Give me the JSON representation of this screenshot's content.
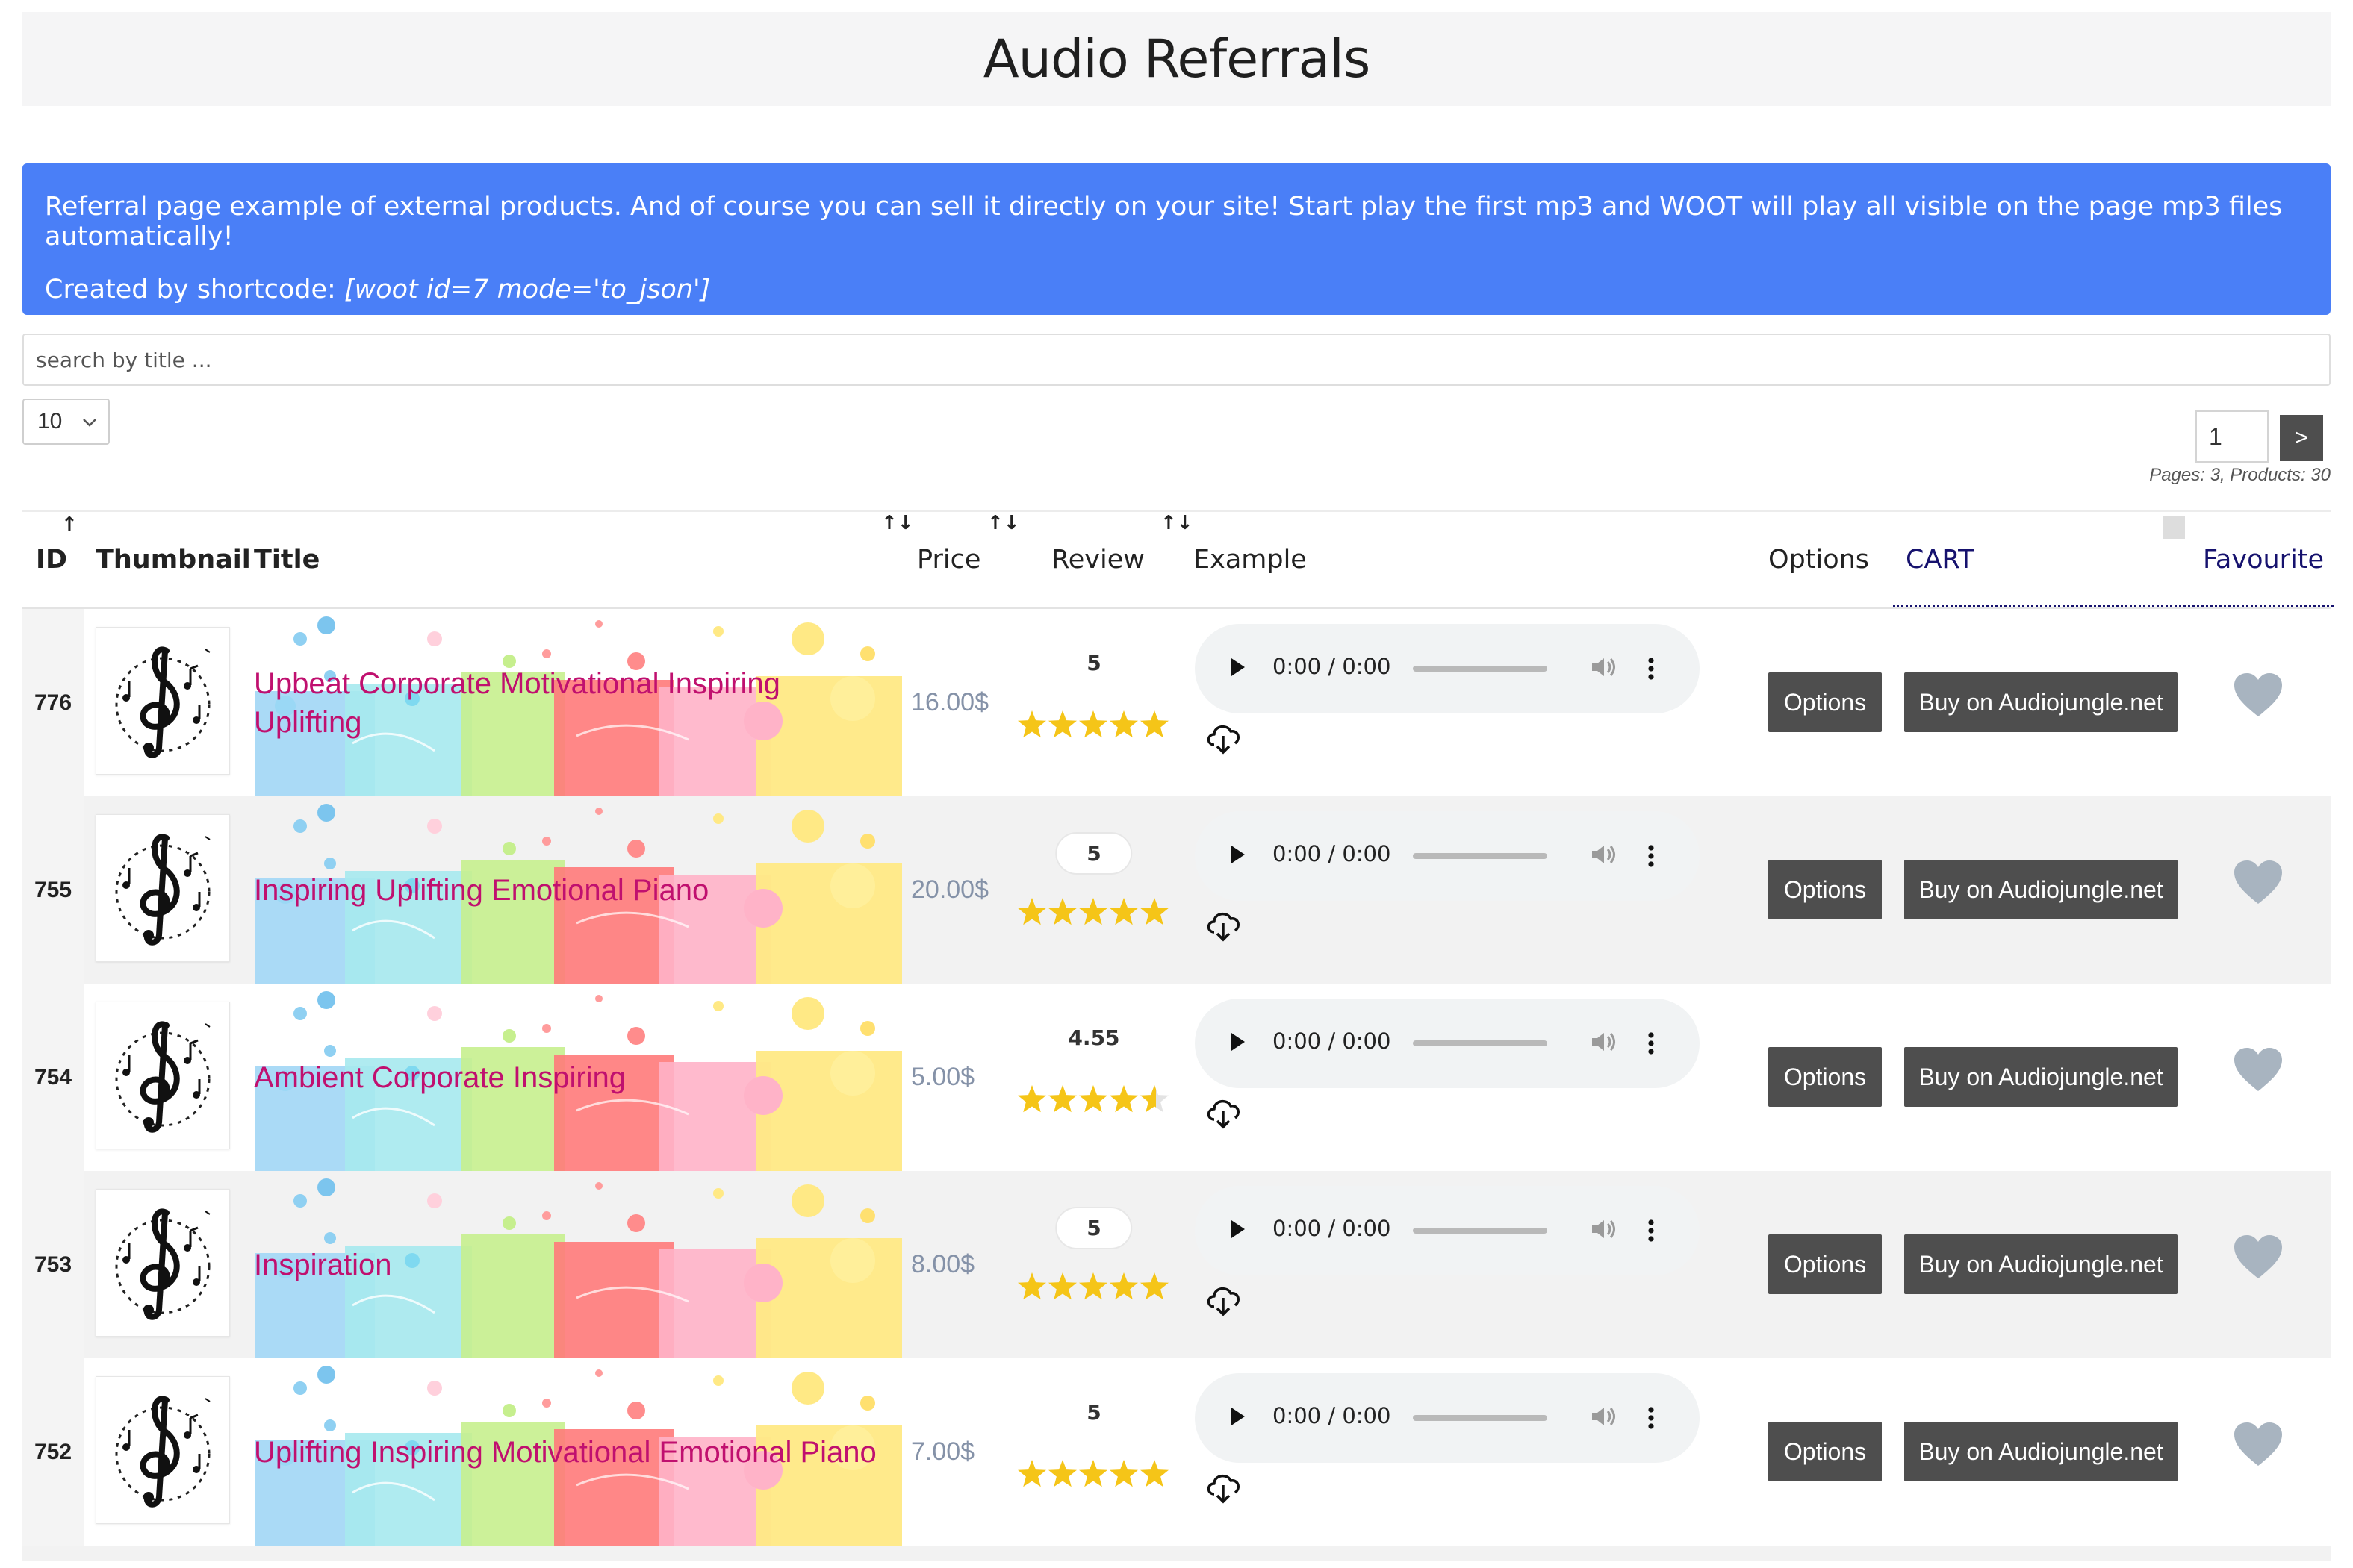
{
  "header": {
    "title": "Audio Referrals"
  },
  "info": {
    "line1": "Referral page example of external products. And of course you can sell it directly on your site! Start play the first mp3 and WOOT will play all visible on the page mp3 files automatically!",
    "line2_prefix": "Created by shortcode: ",
    "line2_code": "[woot id=7 mode='to_json']"
  },
  "search": {
    "placeholder": "search by title ..."
  },
  "per_page": {
    "value": "10"
  },
  "pagination": {
    "page": "1",
    "next_label": ">",
    "summary": "Pages: 3, Products: 30"
  },
  "columns": {
    "id": "ID",
    "thumbnail": "Thumbnail",
    "title": "Title",
    "price": "Price",
    "review": "Review",
    "example": "Example",
    "options": "Options",
    "cart": "CART",
    "favourite": "Favourite"
  },
  "sort_icon": "↑↓",
  "sort_up_icon": "↑",
  "rows": [
    {
      "id": "776",
      "title": "Upbeat Corporate Motivational Inspiring Uplifting",
      "price": "16.00$",
      "rating": 5,
      "rating_label": "5",
      "pill": false,
      "time": "0:00 / 0:00",
      "options": "Options",
      "buy": "Buy on Audiojungle.net"
    },
    {
      "id": "755",
      "title": "Inspiring Uplifting Emotional Piano",
      "price": "20.00$",
      "rating": 5,
      "rating_label": "5",
      "pill": true,
      "time": "0:00 / 0:00",
      "options": "Options",
      "buy": "Buy on Audiojungle.net"
    },
    {
      "id": "754",
      "title": "Ambient Corporate Inspiring",
      "price": "5.00$",
      "rating": 4.55,
      "rating_label": "4.55",
      "pill": false,
      "time": "0:00 / 0:00",
      "options": "Options",
      "buy": "Buy on Audiojungle.net"
    },
    {
      "id": "753",
      "title": "Inspiration",
      "price": "8.00$",
      "rating": 5,
      "rating_label": "5",
      "pill": true,
      "time": "0:00 / 0:00",
      "options": "Options",
      "buy": "Buy on Audiojungle.net"
    },
    {
      "id": "752",
      "title": "Uplifting Inspiring Motivational Emotional Piano",
      "price": "7.00$",
      "rating": 5,
      "rating_label": "5",
      "pill": false,
      "time": "0:00 / 0:00",
      "options": "Options",
      "buy": "Buy on Audiojungle.net"
    }
  ],
  "icons": {
    "thumbnail": "treble-clef-icon",
    "play": "play-icon",
    "volume": "volume-icon",
    "more": "more-vertical-icon",
    "download": "cloud-download-icon",
    "favourite": "heart-icon",
    "star": "star-icon",
    "dropdown": "chevron-down-icon"
  },
  "colors": {
    "info_bg": "#4a7ff7",
    "title_link": "#c0106f",
    "price": "#8592a8",
    "button_bg": "#4e4e4e",
    "star": "#f5c518",
    "heart": "#a8b4c0",
    "cart_header": "#16126e"
  }
}
